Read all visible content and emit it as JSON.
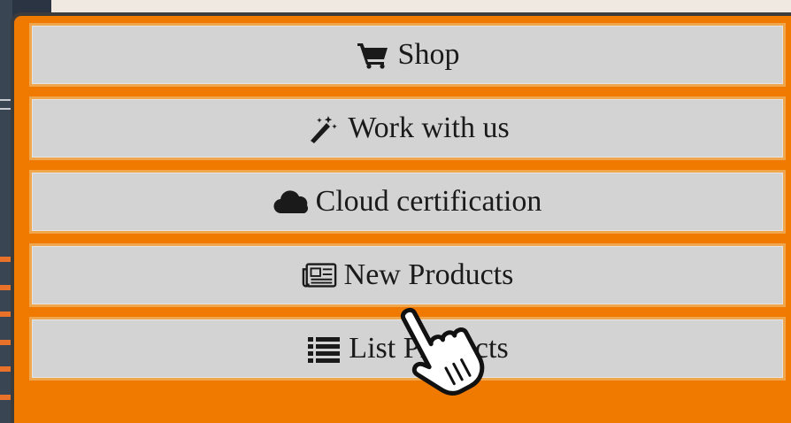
{
  "menu": {
    "items": [
      {
        "label": "Shop",
        "icon": "shopping-cart-icon"
      },
      {
        "label": "Work with us",
        "icon": "magic-wand-icon"
      },
      {
        "label": "Cloud certification",
        "icon": "cloud-icon"
      },
      {
        "label": "New Products",
        "icon": "newspaper-icon"
      },
      {
        "label": "List Products",
        "icon": "list-icon"
      }
    ]
  },
  "colors": {
    "menu_background": "#f07a00",
    "item_background": "#d3d3d3",
    "item_border": "#f0a64d",
    "text": "#1a1a1a",
    "page_background": "#2a3442"
  },
  "cursor": {
    "type": "hand-pointer-icon"
  }
}
